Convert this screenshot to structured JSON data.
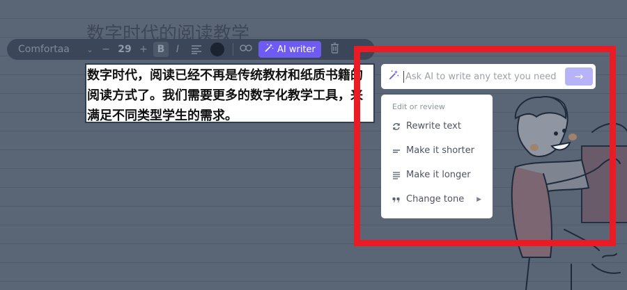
{
  "document": {
    "heading": "数字时代的阅读教学",
    "body_text": "数字时代，阅读已经不再是传统教材和纸质书籍的阅读方式了。我们需要更多的数字化教学工具，来满足不同类型学生的需求。"
  },
  "toolbar": {
    "font_name": "Comfortaa",
    "font_size": "29",
    "minus": "−",
    "plus": "+",
    "bold": "B",
    "italic": "I",
    "text_color": "#1b2230",
    "ai_writer_label": "AI writer"
  },
  "ai_prompt": {
    "placeholder": "Ask AI to write any text you need",
    "send_icon": "arrow-right-icon"
  },
  "ai_menu": {
    "section_title": "Edit or review",
    "items": [
      {
        "label": "Rewrite text",
        "icon": "refresh-icon"
      },
      {
        "label": "Make it shorter",
        "icon": "short-lines-icon"
      },
      {
        "label": "Make it longer",
        "icon": "long-lines-icon"
      },
      {
        "label": "Change tone",
        "icon": "quote-icon",
        "has_submenu": true
      }
    ]
  },
  "colors": {
    "accent": "#6e5bf2",
    "highlight_box": "#ea1b25",
    "canvas": "#5a6576"
  }
}
